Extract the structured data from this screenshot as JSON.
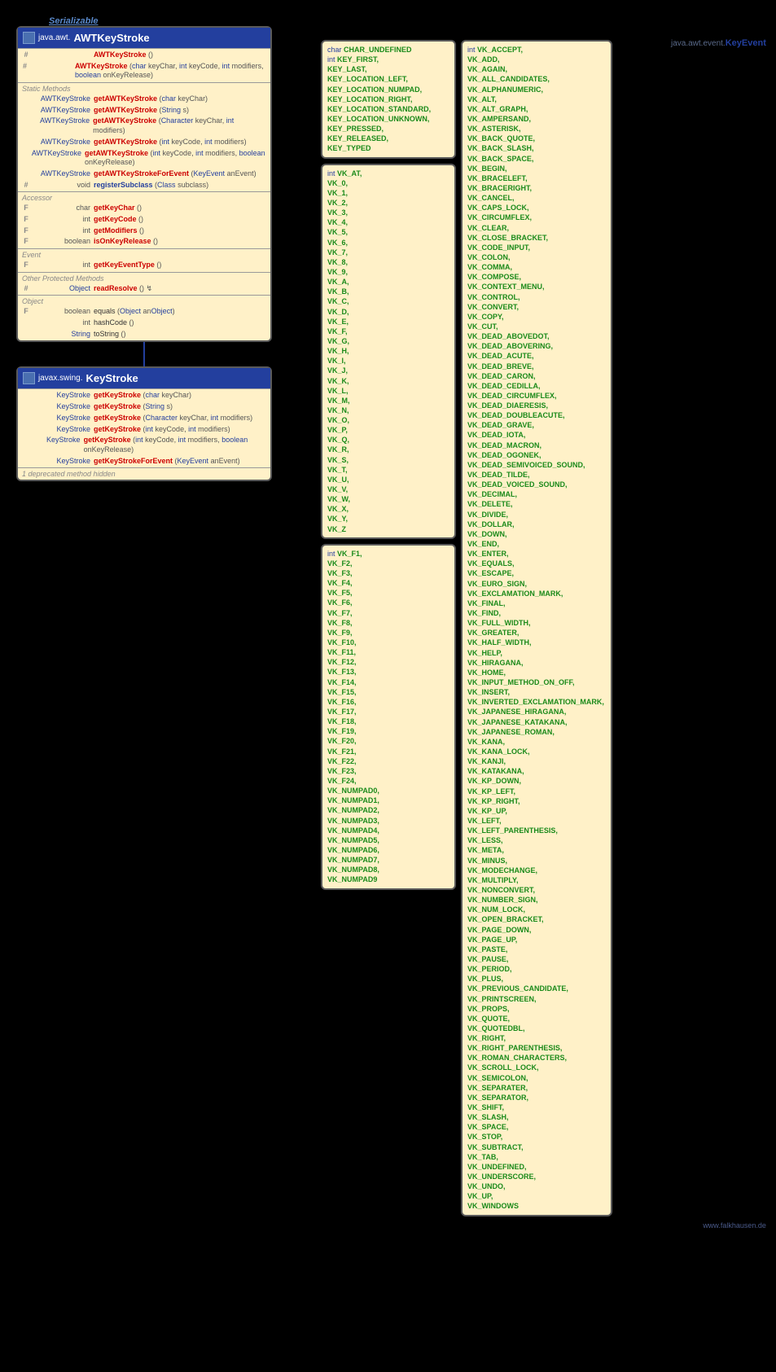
{
  "serializable": "Serializable",
  "keyeventHeader": {
    "pkg": "java.awt.event.",
    "cls": "KeyEvent"
  },
  "awtkeystroke": {
    "pkg": "java.awt.",
    "name": "AWTKeyStroke",
    "constructors": [
      {
        "mod": "#",
        "ret": "",
        "name": "AWTKeyStroke",
        "params": "()"
      },
      {
        "mod": "#",
        "ret": "",
        "name": "AWTKeyStroke",
        "params": "(char keyChar, int keyCode, int modifiers, boolean onKeyRelease)"
      }
    ],
    "staticMethods": [
      {
        "ret": "AWTKeyStroke",
        "name": "getAWTKeyStroke",
        "params": "(char keyChar)"
      },
      {
        "ret": "AWTKeyStroke",
        "name": "getAWTKeyStroke",
        "params": "(String s)"
      },
      {
        "ret": "AWTKeyStroke",
        "name": "getAWTKeyStroke",
        "params": "(Character keyChar, int modifiers)"
      },
      {
        "ret": "AWTKeyStroke",
        "name": "getAWTKeyStroke",
        "params": "(int keyCode, int modifiers)"
      },
      {
        "ret": "AWTKeyStroke",
        "name": "getAWTKeyStroke",
        "params": "(int keyCode, int modifiers, boolean onKeyRelease)"
      },
      {
        "ret": "AWTKeyStroke",
        "name": "getAWTKeyStrokeForEvent",
        "params": "(KeyEvent anEvent)"
      },
      {
        "mod": "#",
        "ret": "void",
        "name": "registerSubclass",
        "params": "(Class<?> subclass)",
        "dark": true
      }
    ],
    "accessor": [
      {
        "mod": "F",
        "ret": "char",
        "name": "getKeyChar",
        "params": "()"
      },
      {
        "mod": "F",
        "ret": "int",
        "name": "getKeyCode",
        "params": "()"
      },
      {
        "mod": "F",
        "ret": "int",
        "name": "getModifiers",
        "params": "()"
      },
      {
        "mod": "F",
        "ret": "boolean",
        "name": "isOnKeyRelease",
        "params": "()"
      }
    ],
    "event": [
      {
        "mod": "F",
        "ret": "int",
        "name": "getKeyEventType",
        "params": "()"
      }
    ],
    "otherProtected": [
      {
        "mod": "#",
        "ret": "Object",
        "name": "readResolve",
        "params": "() ↯"
      }
    ],
    "object": [
      {
        "mod": "F",
        "ret": "boolean",
        "name": "equals",
        "params": "(Object anObject)",
        "black": true
      },
      {
        "mod": "",
        "ret": "int",
        "name": "hashCode",
        "params": "()",
        "black": true
      },
      {
        "mod": "",
        "ret": "String",
        "name": "toString",
        "params": "()",
        "black": true
      }
    ]
  },
  "keystroke": {
    "pkg": "javax.swing.",
    "name": "KeyStroke",
    "methods": [
      {
        "ret": "KeyStroke",
        "name": "getKeyStroke",
        "params": "(char keyChar)"
      },
      {
        "ret": "KeyStroke",
        "name": "getKeyStroke",
        "params": "(String s)"
      },
      {
        "ret": "KeyStroke",
        "name": "getKeyStroke",
        "params": "(Character keyChar, int modifiers)"
      },
      {
        "ret": "KeyStroke",
        "name": "getKeyStroke",
        "params": "(int keyCode, int modifiers)"
      },
      {
        "ret": "KeyStroke",
        "name": "getKeyStroke",
        "params": "(int keyCode, int modifiers, boolean onKeyRelease)"
      },
      {
        "ret": "KeyStroke",
        "name": "getKeyStrokeForEvent",
        "params": "(KeyEvent anEvent)"
      }
    ],
    "deprecated": "1 deprecated method hidden"
  },
  "constCol1": [
    {
      "type": "char",
      "items": [
        "CHAR_UNDEFINED"
      ]
    },
    {
      "type": "int",
      "items": [
        "KEY_FIRST,",
        "KEY_LAST,",
        "KEY_LOCATION_LEFT,",
        "KEY_LOCATION_NUMPAD,",
        "KEY_LOCATION_RIGHT,",
        "KEY_LOCATION_STANDARD,",
        "KEY_LOCATION_UNKNOWN,",
        "KEY_PRESSED,",
        "KEY_RELEASED,",
        "KEY_TYPED"
      ]
    }
  ],
  "constCol1b": {
    "type": "int",
    "items": [
      "VK_AT,",
      "VK_0,",
      "VK_1,",
      "VK_2,",
      "VK_3,",
      "VK_4,",
      "VK_5,",
      "VK_6,",
      "VK_7,",
      "VK_8,",
      "VK_9,",
      "VK_A,",
      "VK_B,",
      "VK_C,",
      "VK_D,",
      "VK_E,",
      "VK_F,",
      "VK_G,",
      "VK_H,",
      "VK_I,",
      "VK_J,",
      "VK_K,",
      "VK_L,",
      "VK_M,",
      "VK_N,",
      "VK_O,",
      "VK_P,",
      "VK_Q,",
      "VK_R,",
      "VK_S,",
      "VK_T,",
      "VK_U,",
      "VK_V,",
      "VK_W,",
      "VK_X,",
      "VK_Y,",
      "VK_Z"
    ]
  },
  "constCol1c": {
    "type": "int",
    "items": [
      "VK_F1,",
      "VK_F2,",
      "VK_F3,",
      "VK_F4,",
      "VK_F5,",
      "VK_F6,",
      "VK_F7,",
      "VK_F8,",
      "VK_F9,",
      "VK_F10,",
      "VK_F11,",
      "VK_F12,",
      "VK_F13,",
      "VK_F14,",
      "VK_F15,",
      "VK_F16,",
      "VK_F17,",
      "VK_F18,",
      "VK_F19,",
      "VK_F20,",
      "VK_F21,",
      "VK_F22,",
      "VK_F23,",
      "VK_F24,",
      "VK_NUMPAD0,",
      "VK_NUMPAD1,",
      "VK_NUMPAD2,",
      "VK_NUMPAD3,",
      "VK_NUMPAD4,",
      "VK_NUMPAD5,",
      "VK_NUMPAD6,",
      "VK_NUMPAD7,",
      "VK_NUMPAD8,",
      "VK_NUMPAD9"
    ]
  },
  "constCol2": {
    "type": "int",
    "items": [
      "VK_ACCEPT,",
      "VK_ADD,",
      "VK_AGAIN,",
      "VK_ALL_CANDIDATES,",
      "VK_ALPHANUMERIC,",
      "VK_ALT,",
      "VK_ALT_GRAPH,",
      "VK_AMPERSAND,",
      "VK_ASTERISK,",
      "VK_BACK_QUOTE,",
      "VK_BACK_SLASH,",
      "VK_BACK_SPACE,",
      "VK_BEGIN,",
      "VK_BRACELEFT,",
      "VK_BRACERIGHT,",
      "VK_CANCEL,",
      "VK_CAPS_LOCK,",
      "VK_CIRCUMFLEX,",
      "VK_CLEAR,",
      "VK_CLOSE_BRACKET,",
      "VK_CODE_INPUT,",
      "VK_COLON,",
      "VK_COMMA,",
      "VK_COMPOSE,",
      "VK_CONTEXT_MENU,",
      "VK_CONTROL,",
      "VK_CONVERT,",
      "VK_COPY,",
      "VK_CUT,",
      "VK_DEAD_ABOVEDOT,",
      "VK_DEAD_ABOVERING,",
      "VK_DEAD_ACUTE,",
      "VK_DEAD_BREVE,",
      "VK_DEAD_CARON,",
      "VK_DEAD_CEDILLA,",
      "VK_DEAD_CIRCUMFLEX,",
      "VK_DEAD_DIAERESIS,",
      "VK_DEAD_DOUBLEACUTE,",
      "VK_DEAD_GRAVE,",
      "VK_DEAD_IOTA,",
      "VK_DEAD_MACRON,",
      "VK_DEAD_OGONEK,",
      "VK_DEAD_SEMIVOICED_SOUND,",
      "VK_DEAD_TILDE,",
      "VK_DEAD_VOICED_SOUND,",
      "VK_DECIMAL,",
      "VK_DELETE,",
      "VK_DIVIDE,",
      "VK_DOLLAR,",
      "VK_DOWN,",
      "VK_END,",
      "VK_ENTER,",
      "VK_EQUALS,",
      "VK_ESCAPE,",
      "VK_EURO_SIGN,",
      "VK_EXCLAMATION_MARK,",
      "VK_FINAL,",
      "VK_FIND,",
      "VK_FULL_WIDTH,",
      "VK_GREATER,",
      "VK_HALF_WIDTH,",
      "VK_HELP,",
      "VK_HIRAGANA,",
      "VK_HOME,",
      "VK_INPUT_METHOD_ON_OFF,",
      "VK_INSERT,",
      "VK_INVERTED_EXCLAMATION_MARK,",
      "VK_JAPANESE_HIRAGANA,",
      "VK_JAPANESE_KATAKANA,",
      "VK_JAPANESE_ROMAN,",
      "VK_KANA,",
      "VK_KANA_LOCK,",
      "VK_KANJI,",
      "VK_KATAKANA,",
      "VK_KP_DOWN,",
      "VK_KP_LEFT,",
      "VK_KP_RIGHT,",
      "VK_KP_UP,",
      "VK_LEFT,",
      "VK_LEFT_PARENTHESIS,",
      "VK_LESS,",
      "VK_META,",
      "VK_MINUS,",
      "VK_MODECHANGE,",
      "VK_MULTIPLY,",
      "VK_NONCONVERT,",
      "VK_NUMBER_SIGN,",
      "VK_NUM_LOCK,",
      "VK_OPEN_BRACKET,",
      "VK_PAGE_DOWN,",
      "VK_PAGE_UP,",
      "VK_PASTE,",
      "VK_PAUSE,",
      "VK_PERIOD,",
      "VK_PLUS,",
      "VK_PREVIOUS_CANDIDATE,",
      "VK_PRINTSCREEN,",
      "VK_PROPS,",
      "VK_QUOTE,",
      "VK_QUOTEDBL,",
      "VK_RIGHT,",
      "VK_RIGHT_PARENTHESIS,",
      "VK_ROMAN_CHARACTERS,",
      "VK_SCROLL_LOCK,",
      "VK_SEMICOLON,",
      "VK_SEPARATER,",
      "VK_SEPARATOR,",
      "VK_SHIFT,",
      "VK_SLASH,",
      "VK_SPACE,",
      "VK_STOP,",
      "VK_SUBTRACT,",
      "VK_TAB,",
      "VK_UNDEFINED,",
      "VK_UNDERSCORE,",
      "VK_UNDO,",
      "VK_UP,",
      "VK_WINDOWS"
    ]
  },
  "labels": {
    "staticMethods": "Static Methods",
    "accessor": "Accessor",
    "event": "Event",
    "otherProtected": "Other Protected Methods",
    "object": "Object"
  },
  "footer": "www.falkhausen.de"
}
